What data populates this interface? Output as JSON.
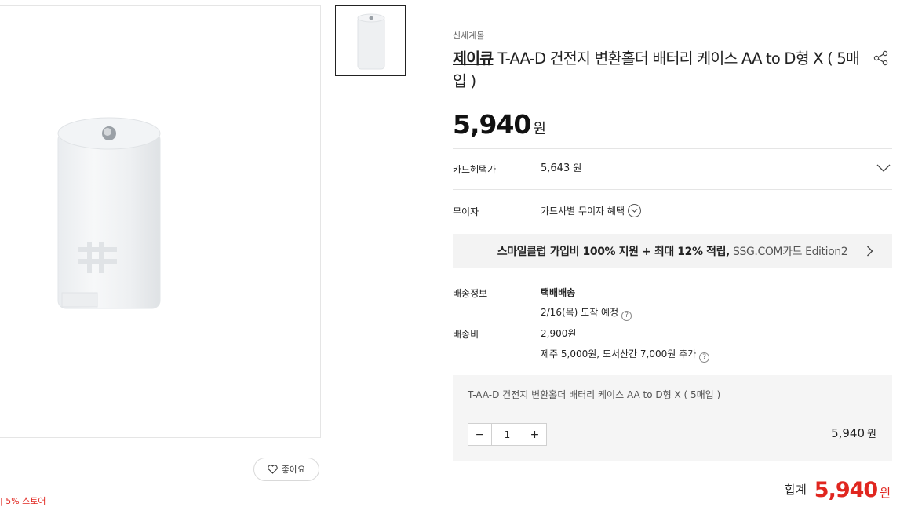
{
  "product": {
    "store": "신세계몰",
    "brand": "제이큐",
    "title": "T-AA-D 건전지 변환홀더 배터리 케이스 AA to D형 X ( 5매입 )",
    "price": "5,940",
    "price_unit": "원"
  },
  "gallery": {
    "like_label": "좋아요",
    "store_badge": "| 5% 스토어"
  },
  "card_benefit": {
    "label": "카드혜택가",
    "value": "5,643",
    "unit": "원"
  },
  "installment": {
    "label": "무이자",
    "value": "카드사별 무이자 혜택"
  },
  "promo": {
    "strong": "스마일클럽 가입비 100% 지원 + 최대 12% 적립,",
    "rest": "SSG.COM카드 Edition2"
  },
  "shipping": {
    "label": "배송정보",
    "method": "택배배송",
    "arrival": "2/16(목) 도착 예정",
    "fee_label": "배송비",
    "fee": "2,900원",
    "extra": "제주 5,000원, 도서산간 7,000원 추가"
  },
  "option": {
    "name": "T-AA-D 건전지 변환홀더 배터리 케이스 AA to D형 X ( 5매입 )",
    "quantity": "1",
    "minus": "−",
    "plus": "+",
    "price": "5,940",
    "unit": "원"
  },
  "total": {
    "label": "합계",
    "price": "5,940",
    "unit": "원"
  },
  "icons": {
    "help": "?"
  }
}
